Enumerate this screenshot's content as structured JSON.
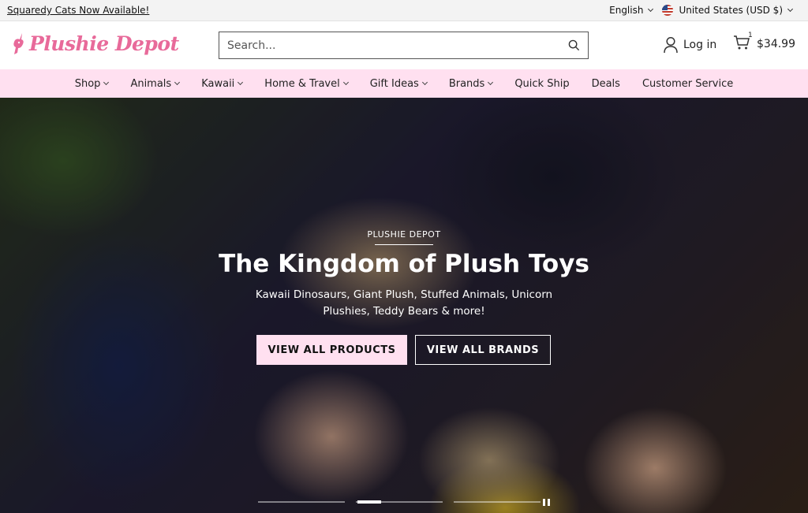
{
  "announcement": {
    "text": "Squaredy Cats Now Available!"
  },
  "locale": {
    "language": "English",
    "country": "United States (USD $)"
  },
  "header": {
    "logo_text": "Plushie Depot",
    "search_placeholder": "Search...",
    "login_label": "Log in",
    "cart_count": "1",
    "cart_total": "$34.99"
  },
  "nav": {
    "items": [
      {
        "label": "Shop",
        "dropdown": true
      },
      {
        "label": "Animals",
        "dropdown": true
      },
      {
        "label": "Kawaii",
        "dropdown": true
      },
      {
        "label": "Home & Travel",
        "dropdown": true
      },
      {
        "label": "Gift Ideas",
        "dropdown": true
      },
      {
        "label": "Brands",
        "dropdown": true
      },
      {
        "label": "Quick Ship",
        "dropdown": false
      },
      {
        "label": "Deals",
        "dropdown": false
      },
      {
        "label": "Customer Service",
        "dropdown": false
      }
    ]
  },
  "hero": {
    "eyebrow": "PLUSHIE DEPOT",
    "title": "The Kingdom of Plush Toys",
    "subtitle": "Kawaii Dinosaurs, Giant Plush, Stuffed Animals, Unicorn Plushies, Teddy Bears & more!",
    "primary_button": "VIEW ALL PRODUCTS",
    "secondary_button": "VIEW ALL BRANDS",
    "slide_count": 3,
    "active_slide": 2
  },
  "colors": {
    "brand_pink": "#e86a9a",
    "nav_bg": "#ffe0f0",
    "announce_bg": "#f3f3f3"
  }
}
